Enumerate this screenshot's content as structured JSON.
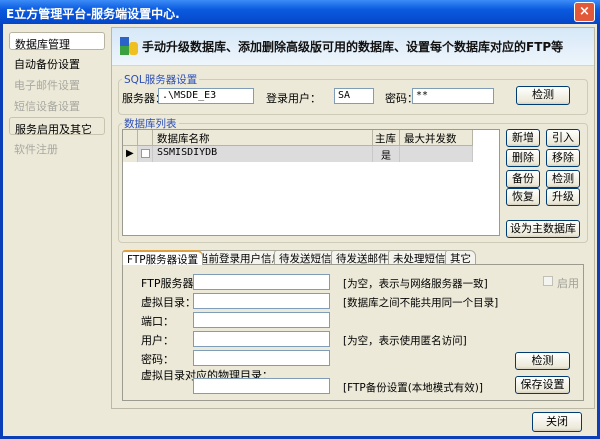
{
  "window": {
    "title": "E立方管理平台-服务端设置中心.",
    "close_glyph": "×"
  },
  "sidebar": {
    "items": [
      {
        "label": "数据库管理",
        "state": "selected"
      },
      {
        "label": "自动备份设置",
        "state": "normal"
      },
      {
        "label": "电子邮件设置",
        "state": "disabled"
      },
      {
        "label": "短信设备设置",
        "state": "disabled"
      },
      {
        "label": "服务启用及其它",
        "state": "normal"
      },
      {
        "label": "软件注册",
        "state": "disabled"
      }
    ]
  },
  "header": {
    "text": "手动升级数据库、添加删除高级版可用的数据库、设置每个数据库对应的FTP等",
    "icon": "database-network-icon"
  },
  "sql": {
    "group_label": "SQL服务器设置",
    "server_label": "服务器：",
    "server_value": ".\\MSDE_E3",
    "user_label": "登录用户：",
    "user_value": "SA",
    "password_label": "密码：",
    "password_value": "**",
    "check_button": "检测"
  },
  "dblist": {
    "group_label": "数据库列表",
    "columns": [
      "数据库名称",
      "主库",
      "最大并发数"
    ],
    "rows": [
      {
        "name": "SSMISDIYDB",
        "primary": "是",
        "max": ""
      }
    ],
    "buttons": {
      "add": "新增",
      "import": "引入",
      "delete": "删除",
      "remove": "移除",
      "backup": "备份",
      "check": "检测",
      "restore": "恢复",
      "upgrade": "升级",
      "set_primary": "设为主数据库"
    }
  },
  "tabs": [
    "FTP服务器设置",
    "当前登录用户信息",
    "待发送短信",
    "待发送邮件",
    "未处理短信",
    "其它"
  ],
  "ftp": {
    "server_label": "FTP服务器：",
    "server_note": "[为空，表示与网络服务器一致]",
    "vdir_label": "虚拟目录：",
    "vdir_note": "[数据库之间不能共用同一个目录]",
    "port_label": "端口：",
    "user_label": "用户：",
    "user_note": "[为空，表示使用匿名访问]",
    "password_label": "密码：",
    "physdir_label": "虚拟目录对应的物理目录：",
    "physdir_note": "[FTP备份设置(本地模式有效)]",
    "enable_label": "启用",
    "check_button": "检测",
    "save_button": "保存设置"
  },
  "footer": {
    "close_button": "关闭"
  }
}
